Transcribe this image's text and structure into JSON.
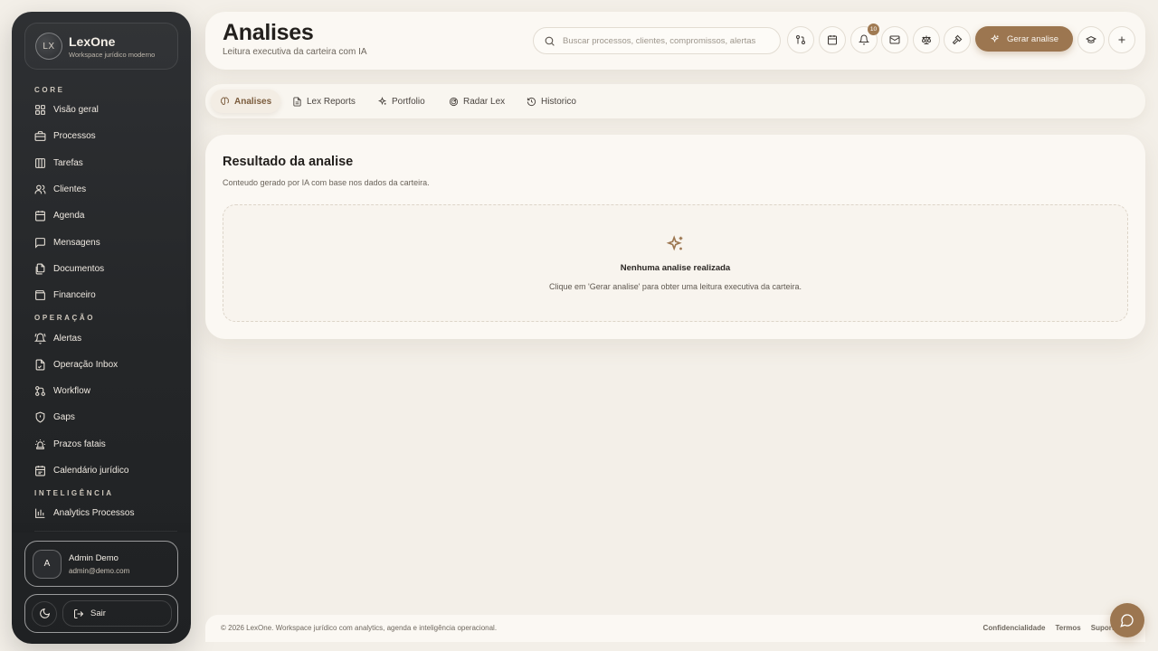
{
  "sidebar": {
    "brand": {
      "logo_text": "LX",
      "name": "LexOne",
      "subtitle": "Workspace jurídico moderno"
    },
    "sections": [
      {
        "label": "CORE",
        "items": [
          {
            "label": "Visão geral",
            "icon": "grid-icon"
          },
          {
            "label": "Processos",
            "icon": "briefcase-icon"
          },
          {
            "label": "Tarefas",
            "icon": "columns-icon"
          },
          {
            "label": "Clientes",
            "icon": "users-icon"
          },
          {
            "label": "Agenda",
            "icon": "calendar-icon"
          },
          {
            "label": "Mensagens",
            "icon": "message-icon"
          },
          {
            "label": "Documentos",
            "icon": "files-icon"
          },
          {
            "label": "Financeiro",
            "icon": "wallet-icon"
          }
        ]
      },
      {
        "label": "OPERAÇÃO",
        "items": [
          {
            "label": "Alertas",
            "icon": "bell-ring-icon"
          },
          {
            "label": "Operação Inbox",
            "icon": "file-inbox-icon"
          },
          {
            "label": "Workflow",
            "icon": "workflow-icon"
          },
          {
            "label": "Gaps",
            "icon": "shield-icon"
          },
          {
            "label": "Prazos fatais",
            "icon": "siren-icon"
          },
          {
            "label": "Calendário jurídico",
            "icon": "calendar-check-icon"
          }
        ]
      },
      {
        "label": "INTELIGÊNCIA",
        "items": [
          {
            "label": "Analytics Processos",
            "icon": "bar-chart-icon"
          }
        ]
      }
    ],
    "user": {
      "avatar": "A",
      "name": "Admin Demo",
      "email": "admin@demo.com"
    },
    "logout_label": "Sair"
  },
  "header": {
    "title": "Analises",
    "subtitle": "Leitura executiva da carteira com IA",
    "search_placeholder": "Buscar processos, clientes, compromissos, alertas",
    "notifications_count": "10",
    "primary_button": "Gerar analise"
  },
  "tabs": [
    {
      "label": "Analises",
      "icon": "brain-icon",
      "active": true
    },
    {
      "label": "Lex Reports",
      "icon": "report-icon",
      "active": false
    },
    {
      "label": "Portfolio",
      "icon": "sparkles-icon",
      "active": false
    },
    {
      "label": "Radar Lex",
      "icon": "radar-icon",
      "active": false
    },
    {
      "label": "Historico",
      "icon": "history-icon",
      "active": false
    }
  ],
  "result": {
    "title": "Resultado da analise",
    "subtitle": "Conteudo gerado por IA com base nos dados da carteira.",
    "empty_title": "Nenhuma analise realizada",
    "empty_desc": "Clique em 'Gerar analise' para obter uma leitura executiva da carteira."
  },
  "footer": {
    "copyright": "© 2026 LexOne. Workspace jurídico com analytics, agenda e inteligência operacional.",
    "links": [
      "Confidencialidade",
      "Termos",
      "Suporte"
    ]
  },
  "colors": {
    "accent": "#9c7650",
    "sidebar_bg": "#242628",
    "page_bg": "#f3efe8"
  }
}
